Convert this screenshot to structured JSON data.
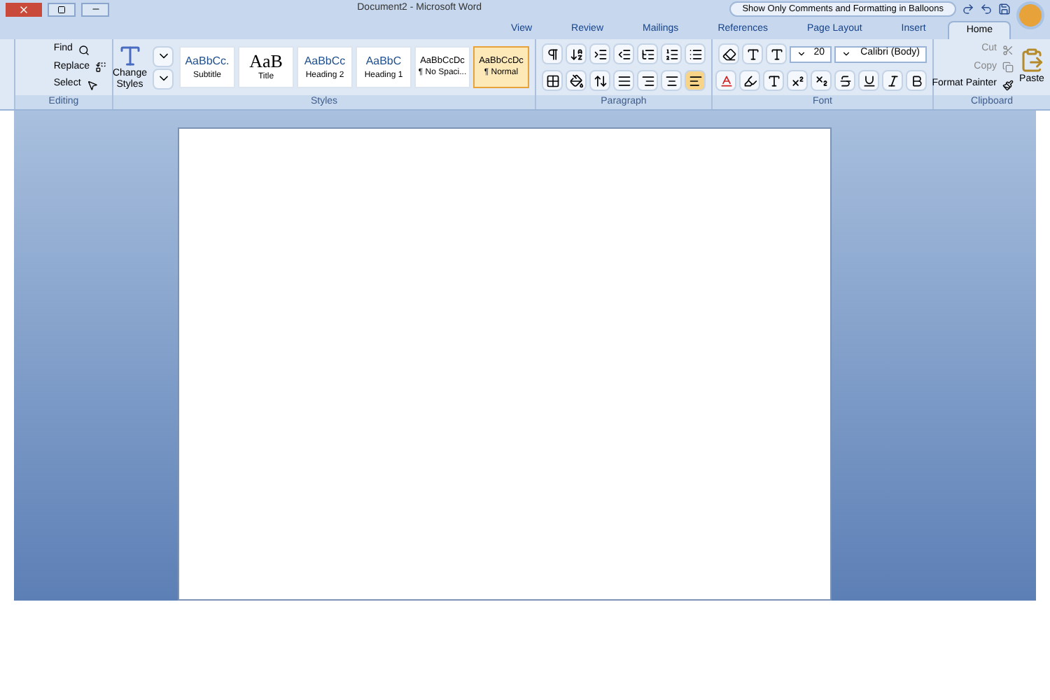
{
  "window": {
    "title": "Document2 - Microsoft Word",
    "quick_access_command": "Show Only Comments and Formatting in Balloons"
  },
  "tabs": [
    {
      "label": "View",
      "selected": false
    },
    {
      "label": "Review",
      "selected": false
    },
    {
      "label": "Mailings",
      "selected": false
    },
    {
      "label": "References",
      "selected": false
    },
    {
      "label": "Page Layout",
      "selected": false
    },
    {
      "label": "Insert",
      "selected": false
    },
    {
      "label": "Home",
      "selected": true
    }
  ],
  "clipboard": {
    "label": "Clipboard",
    "paste": "Paste",
    "cut": "Cut",
    "copy": "Copy",
    "format_painter": "Format Painter"
  },
  "font": {
    "label": "Font",
    "name": "Calibri (Body)",
    "size": "20"
  },
  "paragraph": {
    "label": "Paragraph"
  },
  "styles": {
    "label": "Styles",
    "change_styles": "Change Styles",
    "items": [
      {
        "preview": "AaBbCc.",
        "name": "Subtitle",
        "selected": false
      },
      {
        "preview": "AaB",
        "name": "Title",
        "selected": false
      },
      {
        "preview": "AaBbCc",
        "name": "Heading 2",
        "selected": false
      },
      {
        "preview": "AaBbC",
        "name": "Heading 1",
        "selected": false
      },
      {
        "preview": "AaBbCcDc",
        "name": "¶ No Spaci...",
        "selected": false
      },
      {
        "preview": "AaBbCcDc",
        "name": "¶ Normal",
        "selected": true
      }
    ]
  },
  "editing": {
    "label": "Editing",
    "find": "Find",
    "replace": "Replace",
    "select": "Select"
  }
}
